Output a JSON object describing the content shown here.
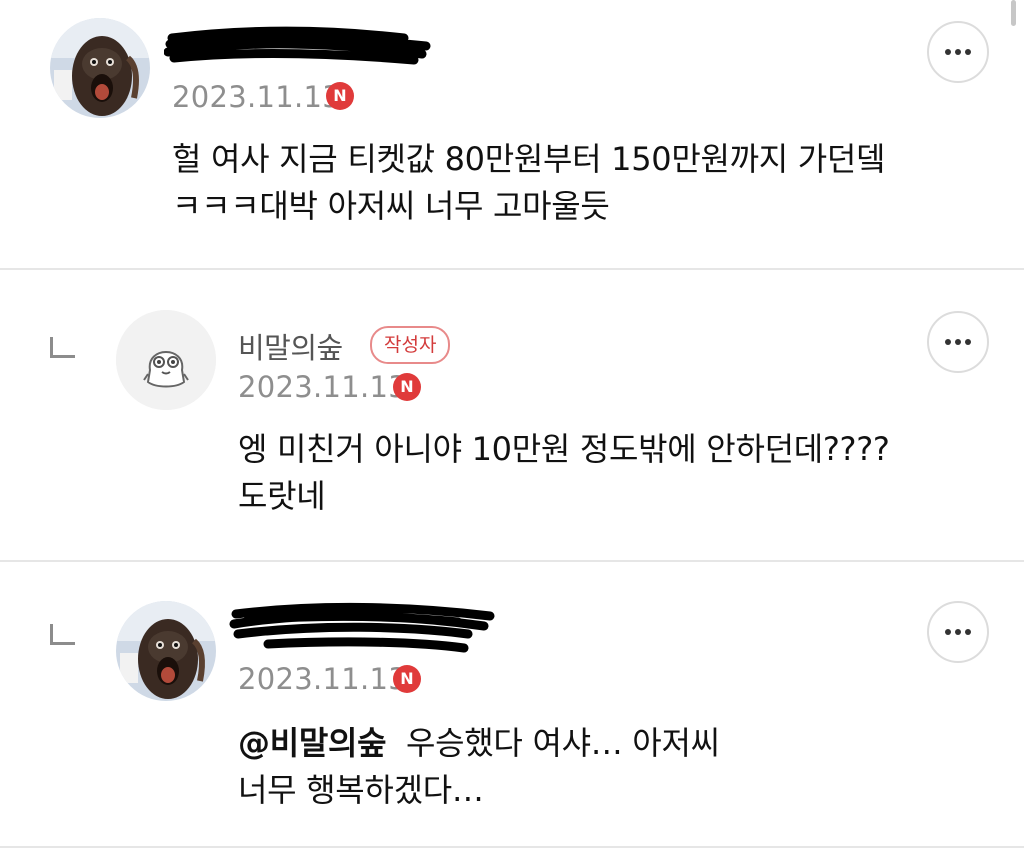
{
  "comments": [
    {
      "name": "",
      "date": "2023.11.13",
      "n_badge": "N",
      "text_lines": [
        "헐 여사 지금 티켓값 80만원부터 150만원까지 가던뎈",
        "ㅋㅋㅋ대박 아저씨 너무 고마울듯"
      ],
      "avatar": "orangutan-avatar",
      "is_reply": false
    },
    {
      "name": "비말의숲",
      "author_badge": "작성자",
      "date": "2023.11.13",
      "n_badge": "N",
      "text_lines": [
        "엥 미친거 아니야 10만원 정도밖에 안하던데????",
        "도랏네"
      ],
      "avatar": "default-character-avatar",
      "is_reply": true
    },
    {
      "name": "",
      "date": "2023.11.13",
      "n_badge": "N",
      "mention": "@비말의숲",
      "text_lines": [
        "우승했다 여샤… 아저씨",
        "너무 행복하겠다…"
      ],
      "avatar": "orangutan-avatar",
      "is_reply": true
    }
  ],
  "icons": {
    "more": "more-horizontal-icon",
    "reply": "reply-arrow-icon",
    "new": "new-badge-icon"
  },
  "colors": {
    "badge_red": "#e03a3a",
    "author_badge_border": "#e88a8a",
    "date_gray": "#8e8e8e",
    "divider": "#e6e6e6"
  }
}
